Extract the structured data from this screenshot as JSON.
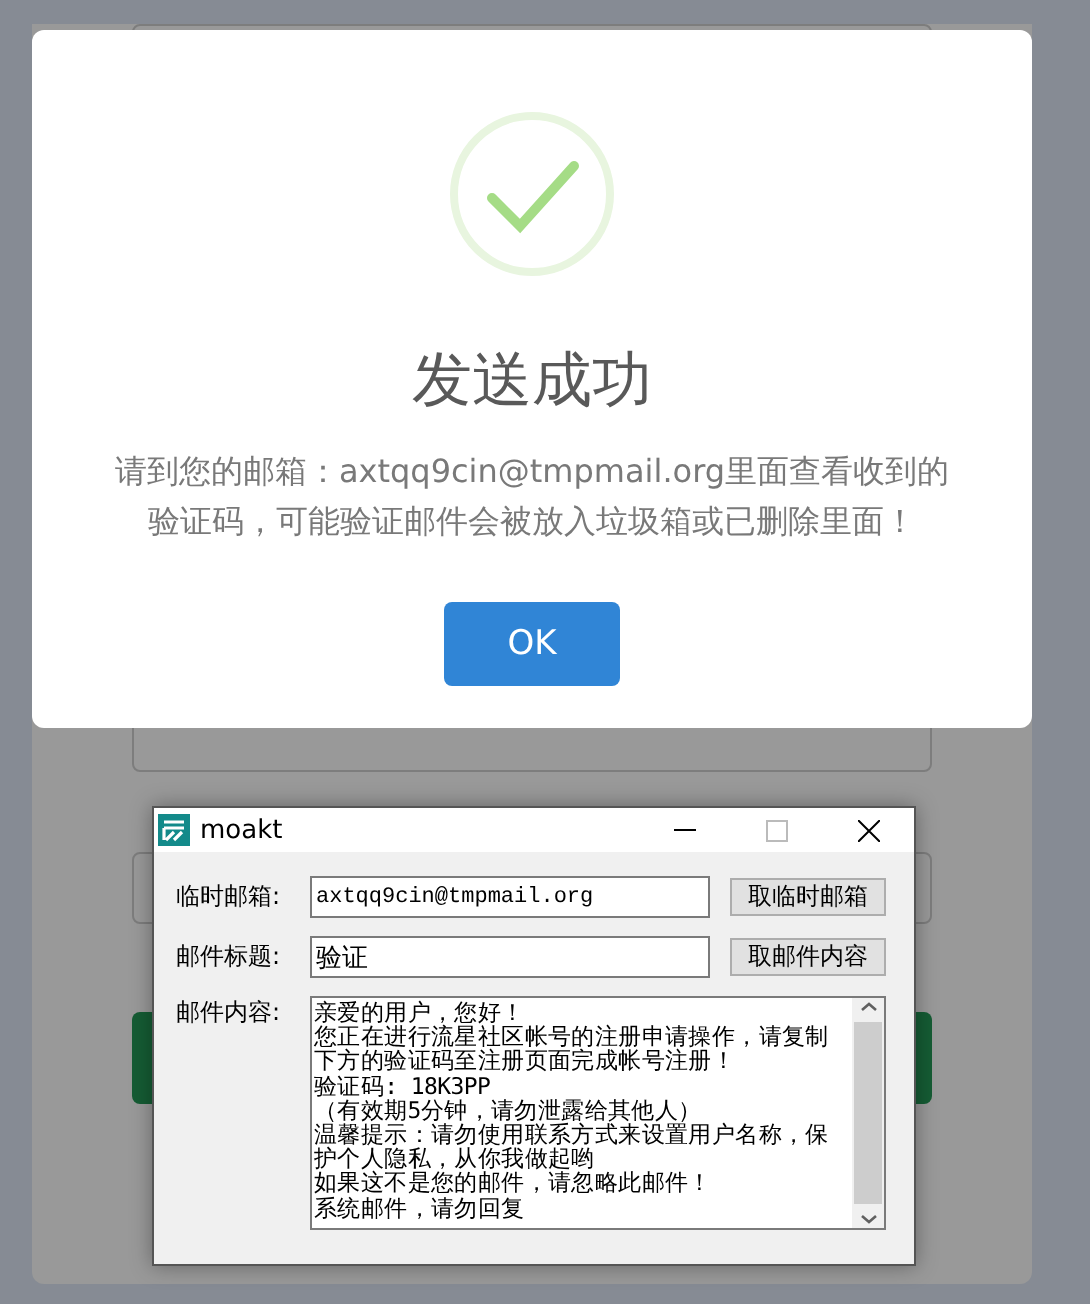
{
  "dialog": {
    "title": "发送成功",
    "message_lines": [
      "请到您的邮箱：axtqq9cin@tmpmail.org里面查看收到的",
      "验证码，可能验证邮件会被放入垃圾箱或已删除里面！"
    ],
    "confirm_button": "OK"
  },
  "window": {
    "title": "moakt",
    "fields": [
      {
        "label": "临时邮箱:",
        "value": "axtqq9cin@tmpmail.org",
        "button": "取临时邮箱"
      },
      {
        "label": "邮件标题:",
        "value": "验证",
        "button": "取邮件内容"
      }
    ],
    "content_label": "邮件内容:",
    "content_lines": [
      "亲爱的用户，您好！",
      "您正在进行流星社区帐号的注册申请操作，请复制",
      "下方的验证码至注册页面完成帐号注册！",
      "验证码: 18K3PP",
      "（有效期5分钟，请勿泄露给其他人）",
      "温馨提示：请勿使用联系方式来设置用户名称，保",
      "护个人隐私，从你我做起哟",
      "如果这不是您的邮件，请忽略此邮件！",
      "系统邮件，请勿回复"
    ]
  }
}
